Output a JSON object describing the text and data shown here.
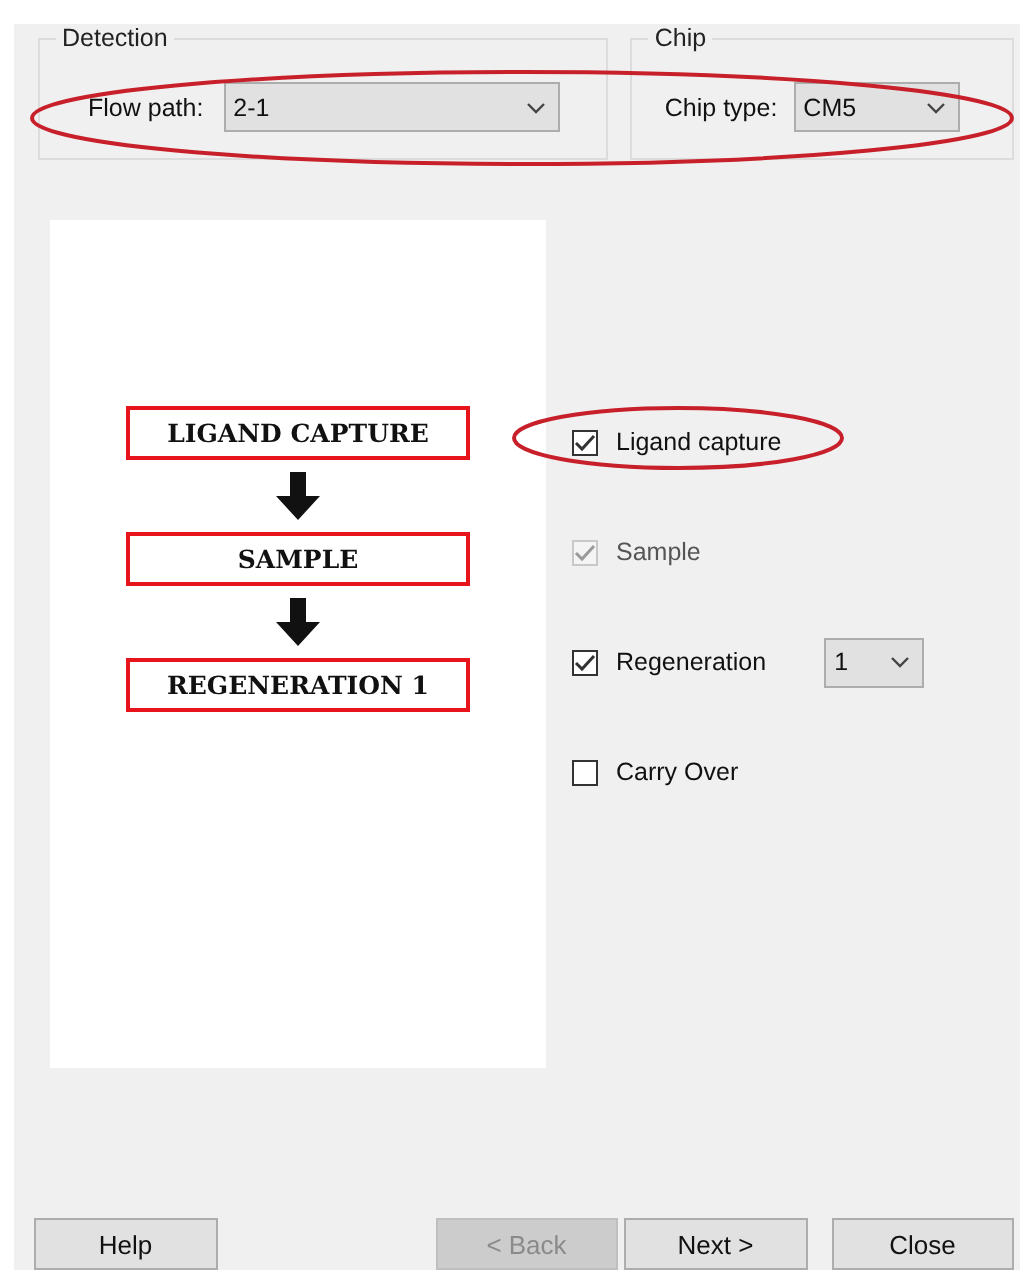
{
  "detection": {
    "title": "Detection",
    "label": "Flow path:",
    "value": "2-1"
  },
  "chip": {
    "title": "Chip",
    "label": "Chip type:",
    "value": "CM5"
  },
  "flowchart": {
    "steps": [
      "LIGAND CAPTURE",
      "SAMPLE",
      "REGENERATION 1"
    ]
  },
  "options": [
    {
      "kind": "checkbox",
      "label": "Ligand capture",
      "checked": true,
      "disabled": false
    },
    {
      "kind": "checkbox",
      "label": "Sample",
      "checked": true,
      "disabled": true
    },
    {
      "kind": "checkbox-dropdown",
      "label": "Regeneration",
      "checked": true,
      "disabled": false,
      "value": "1"
    },
    {
      "kind": "checkbox",
      "label": "Carry Over",
      "checked": false,
      "disabled": false
    }
  ],
  "buttons": [
    {
      "label": "Help",
      "disabled": false
    },
    {
      "label": "< Back",
      "disabled": true
    },
    {
      "label": "Next >",
      "disabled": false
    },
    {
      "label": "Close",
      "disabled": false
    }
  ]
}
